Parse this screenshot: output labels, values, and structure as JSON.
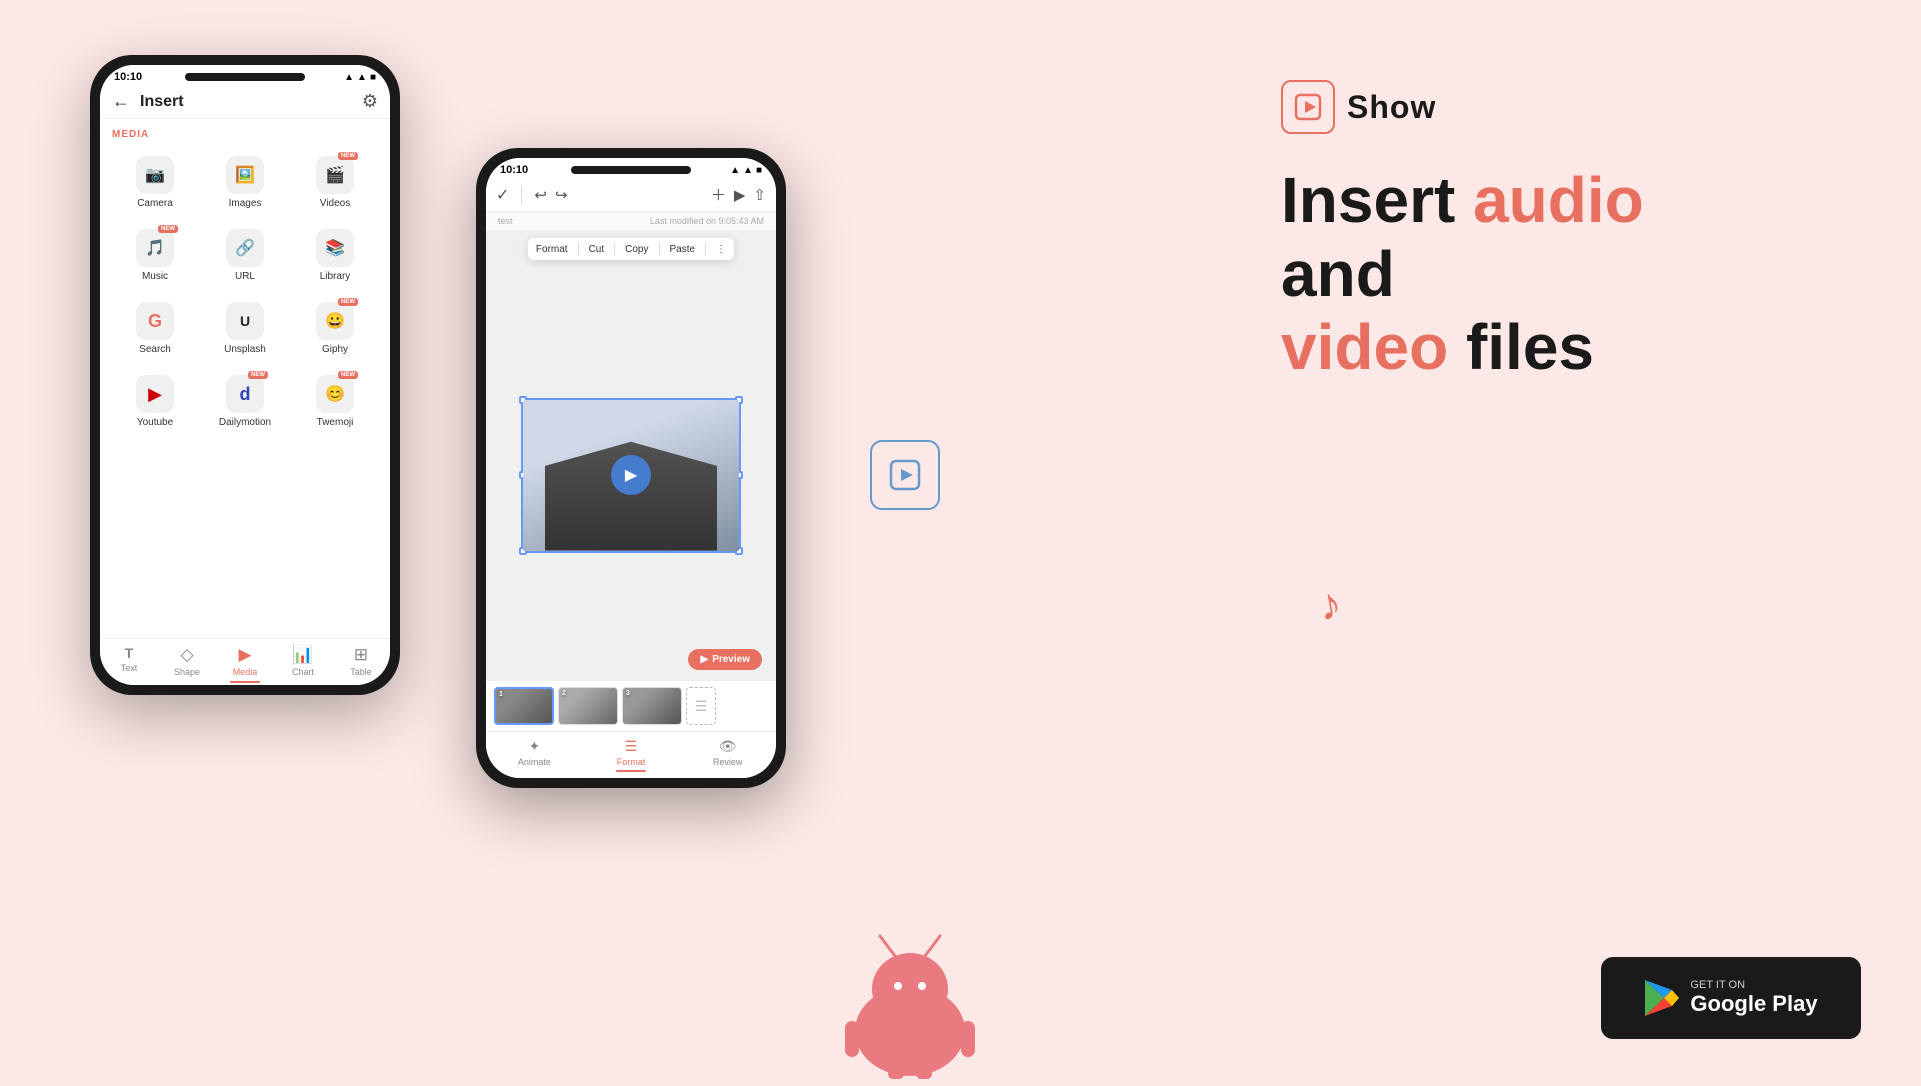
{
  "background_color": "#fce8e6",
  "brand": {
    "name": "Show",
    "logo_aria": "Show app logo"
  },
  "headline": {
    "line1_black": "Insert ",
    "line1_accent": "audio",
    "line2_black": "and",
    "line3_accent": "video",
    "line3_black": " files"
  },
  "left_phone": {
    "status_time": "10:10",
    "status_icons": "▲ ▲ ■",
    "header_title": "Insert",
    "section_media": "MEDIA",
    "items": [
      {
        "label": "Camera",
        "icon": "📷",
        "badge": false
      },
      {
        "label": "Images",
        "icon": "🖼️",
        "badge": false
      },
      {
        "label": "Videos",
        "icon": "🎬",
        "badge": true
      },
      {
        "label": "Music",
        "icon": "🎵",
        "badge": true
      },
      {
        "label": "URL",
        "icon": "🔗",
        "badge": false
      },
      {
        "label": "Library",
        "icon": "📚",
        "badge": false
      },
      {
        "label": "Search",
        "icon": "G",
        "badge": false
      },
      {
        "label": "Unsplash",
        "icon": "⬛",
        "badge": false
      },
      {
        "label": "Giphy",
        "icon": "😀",
        "badge": true
      },
      {
        "label": "Youtube",
        "icon": "▶",
        "badge": false
      },
      {
        "label": "Dailymotion",
        "icon": "d",
        "badge": true
      },
      {
        "label": "Twemoji",
        "icon": "😊",
        "badge": true
      }
    ],
    "nav_items": [
      {
        "label": "Text",
        "icon": "T",
        "active": false
      },
      {
        "label": "Shape",
        "icon": "◇",
        "active": false
      },
      {
        "label": "Media",
        "icon": "▶",
        "active": true
      },
      {
        "label": "Chart",
        "icon": "📊",
        "active": false
      },
      {
        "label": "Table",
        "icon": "⊞",
        "active": false
      }
    ]
  },
  "right_phone": {
    "status_time": "10:10",
    "filename": "test",
    "last_modified": "Last modified on 9:05:43 AM",
    "context_menu": [
      "Format",
      "Cut",
      "Copy",
      "Paste",
      "⋮"
    ],
    "preview_label": "Preview",
    "thumbnails": [
      {
        "num": "1",
        "active": true
      },
      {
        "num": "2",
        "active": false
      },
      {
        "num": "3",
        "active": false
      }
    ],
    "bottom_tabs": [
      {
        "label": "Animate",
        "active": false
      },
      {
        "label": "Format",
        "active": true
      },
      {
        "label": "Review",
        "active": false
      }
    ]
  },
  "google_play": {
    "get_it_on": "GET IT ON",
    "store_name": "Google Play"
  },
  "floating_icons": {
    "video_icon_aria": "video file icon",
    "music_icon_aria": "music note icon"
  }
}
